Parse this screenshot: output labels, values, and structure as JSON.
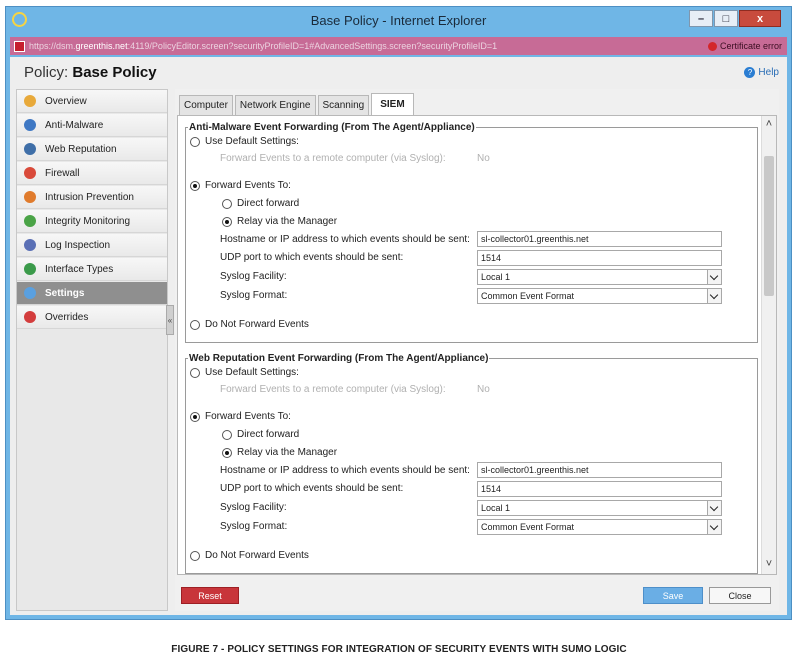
{
  "window": {
    "title": "Base Policy - Internet Explorer",
    "controls": {
      "minimize": "–",
      "maximize": "□",
      "close": "x"
    }
  },
  "address": {
    "prefix": "https://dsm.",
    "host": "greenthis.net",
    "rest": ":4119/PolicyEditor.screen?securityProfileID=1#AdvancedSettings.screen?securityProfileID=1",
    "cert_error": "Certificate error"
  },
  "header": {
    "policy_label": "Policy:",
    "policy_name": "Base Policy",
    "help": "Help"
  },
  "sidebar": {
    "items": [
      {
        "label": "Overview",
        "icon": "overview-icon",
        "color": "#e8a93a"
      },
      {
        "label": "Anti-Malware",
        "icon": "shield-icon",
        "color": "#3f78c4"
      },
      {
        "label": "Web Reputation",
        "icon": "globe-icon",
        "color": "#3f6fa8"
      },
      {
        "label": "Firewall",
        "icon": "firewall-icon",
        "color": "#d94a3a"
      },
      {
        "label": "Intrusion Prevention",
        "icon": "intrusion-icon",
        "color": "#e07b2c"
      },
      {
        "label": "Integrity Monitoring",
        "icon": "integrity-icon",
        "color": "#4aa346"
      },
      {
        "label": "Log Inspection",
        "icon": "log-icon",
        "color": "#5a6fb5"
      },
      {
        "label": "Interface Types",
        "icon": "interface-icon",
        "color": "#3b9a4a"
      },
      {
        "label": "Settings",
        "icon": "gear-icon",
        "color": "#5aa0e0",
        "active": true
      },
      {
        "label": "Overrides",
        "icon": "overrides-icon",
        "color": "#d33d3d"
      }
    ],
    "collapse": "«"
  },
  "tabs": [
    "Computer",
    "Network Engine",
    "Scanning",
    "SIEM"
  ],
  "active_tab": "SIEM",
  "groups": [
    {
      "legend": "Anti-Malware Event Forwarding (From The Agent/Appliance)",
      "use_default": "Use Default Settings:",
      "default_sub_label": "Forward Events to a remote computer (via Syslog):",
      "default_sub_value": "No",
      "forward_to": "Forward Events To:",
      "direct": "Direct forward",
      "relay": "Relay via the Manager",
      "hostname_label": "Hostname or IP address to which events should be sent:",
      "hostname_value": "sl-collector01.greenthis.net",
      "port_label": "UDP port to which events should be sent:",
      "port_value": "1514",
      "facility_label": "Syslog Facility:",
      "facility_value": "Local 1",
      "format_label": "Syslog Format:",
      "format_value": "Common Event Format",
      "do_not": "Do Not Forward Events"
    },
    {
      "legend": "Web Reputation Event Forwarding (From The Agent/Appliance)",
      "use_default": "Use Default Settings:",
      "default_sub_label": "Forward Events to a remote computer (via Syslog):",
      "default_sub_value": "No",
      "forward_to": "Forward Events To:",
      "direct": "Direct forward",
      "relay": "Relay via the Manager",
      "hostname_label": "Hostname or IP address to which events should be sent:",
      "hostname_value": "sl-collector01.greenthis.net",
      "port_label": "UDP port to which events should be sent:",
      "port_value": "1514",
      "facility_label": "Syslog Facility:",
      "facility_value": "Local 1",
      "format_label": "Syslog Format:",
      "format_value": "Common Event Format",
      "do_not": "Do Not Forward Events"
    }
  ],
  "buttons": {
    "reset": "Reset",
    "save": "Save",
    "close": "Close"
  },
  "caption": "FIGURE 7 - POLICY SETTINGS FOR INTEGRATION OF SECURITY EVENTS WITH SUMO LOGIC"
}
